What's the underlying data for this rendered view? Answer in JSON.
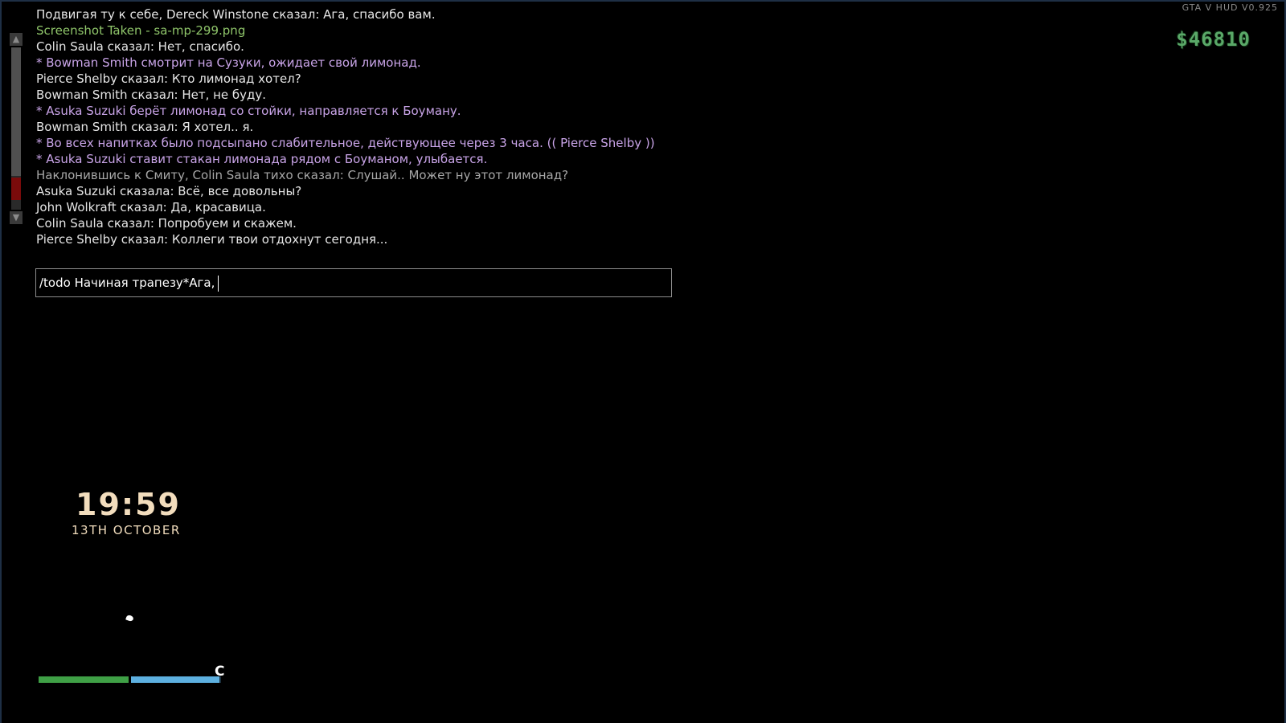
{
  "hud": {
    "version": "GTA V HUD V0.925",
    "money": "$46810",
    "clock_time": "19:59",
    "clock_date": "13TH OCTOBER",
    "bar_letter": "C",
    "health_level": 1.0,
    "armor_level": 0.98
  },
  "scrollbar": {
    "up_icon": "▲",
    "down_icon": "▼"
  },
  "chat": {
    "messages": [
      {
        "text": "Подвигая ту к себе, Dereck Winstone сказал: Ага, спасибо вам.",
        "type": "normal"
      },
      {
        "text": "Screenshot Taken - sa-mp-299.png",
        "type": "system"
      },
      {
        "text": "Colin Saula сказал: Нет, спасибо.",
        "type": "normal"
      },
      {
        "text": "* Bowman Smith смотрит на Сузуки, ожидает свой лимонад.",
        "type": "action"
      },
      {
        "text": "Pierce Shelby сказал: Кто лимонад хотел?",
        "type": "normal"
      },
      {
        "text": "Bowman Smith сказал: Нет, не буду.",
        "type": "normal"
      },
      {
        "text": "* Asuka Suzuki берёт лимонад со стойки, направляется к Боуману.",
        "type": "action"
      },
      {
        "text": "Bowman Smith сказал: Я хотел.. я.",
        "type": "normal"
      },
      {
        "text": "* Во всех напитках было подсыпано слабительное, действующее через 3 часа. (( Pierce Shelby ))",
        "type": "action"
      },
      {
        "text": "* Asuka Suzuki ставит стакан лимонада рядом с Боуманом, улыбается.",
        "type": "action"
      },
      {
        "text": "Наклонившись к Смиту, Colin Saula тихо сказал: Слушай.. Может ну этот лимонад?",
        "type": "whisper"
      },
      {
        "text": "Asuka Suzuki сказала: Всё, все довольны?",
        "type": "normal"
      },
      {
        "text": "John Wolkraft сказал: Да, красавица.",
        "type": "normal"
      },
      {
        "text": "Colin Saula сказал: Попробуем и скажем.",
        "type": "normal"
      },
      {
        "text": "Pierce Shelby сказал: Коллеги твои отдохнут сегодня...",
        "type": "normal"
      }
    ],
    "input_value": "/todo Начиная трапезу*Ага,"
  },
  "colors": {
    "normal": "#e6e6e6",
    "system": "#8fc56a",
    "action": "#c9a4e8",
    "whisper": "#a7a7a7",
    "money": "#5aa868",
    "clock": "#f2ddbd",
    "health": "#3fa046",
    "armor": "#5db0e0"
  }
}
